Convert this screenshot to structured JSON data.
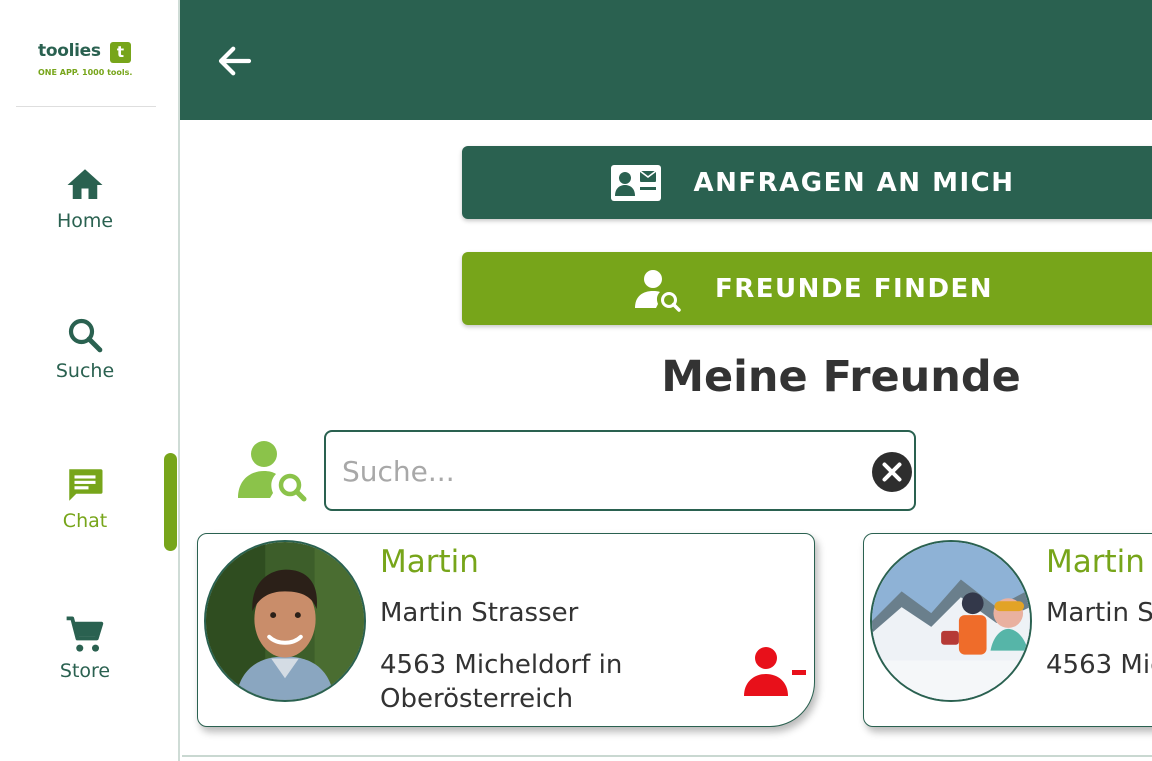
{
  "brand": {
    "name": "toolies",
    "badge": "t",
    "tagline": "ONE APP. 1000 tools."
  },
  "sidebar": {
    "items": [
      {
        "label": "Home",
        "icon": "home-icon"
      },
      {
        "label": "Suche",
        "icon": "search-icon"
      },
      {
        "label": "Chat",
        "icon": "chat-icon",
        "active": true
      },
      {
        "label": "Store",
        "icon": "cart-icon"
      }
    ]
  },
  "header": {
    "back_icon": "arrow-left-icon"
  },
  "actions": {
    "requests_label": "ANFRAGEN AN MICH",
    "find_friends_label": "FREUNDE FINDEN"
  },
  "section": {
    "title": "Meine Freunde"
  },
  "search": {
    "placeholder": "Suche...",
    "value": ""
  },
  "friends": [
    {
      "nickname": "Martin",
      "name": "Martin Strasser",
      "location": "4563 Micheldorf in Oberösterreich"
    },
    {
      "nickname": "Martin S",
      "name": "Martin S",
      "location": "4563 Mic"
    }
  ],
  "colors": {
    "primary": "#2a6150",
    "accent": "#77a51a",
    "danger": "#e8101a",
    "text": "#333333"
  }
}
